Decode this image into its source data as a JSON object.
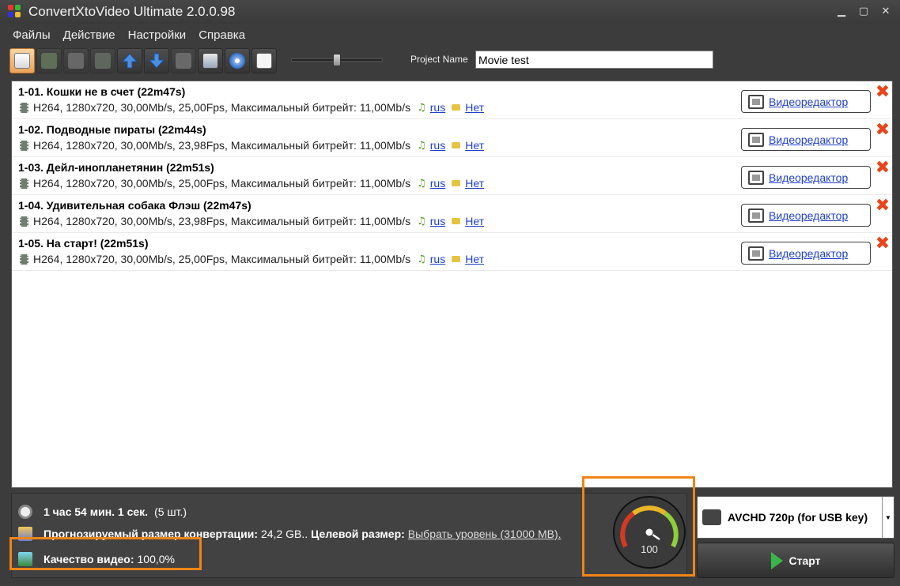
{
  "window": {
    "title": "ConvertXtoVideo Ultimate 2.0.0.98"
  },
  "menu": [
    "Файлы",
    "Действие",
    "Настройки",
    "Справка"
  ],
  "toolbar": {
    "buttons": [
      {
        "icon": "add-file-icon",
        "state": "active"
      },
      {
        "icon": "add-audio-icon",
        "state": "disabled"
      },
      {
        "icon": "add-subtitle-icon",
        "state": "disabled"
      },
      {
        "icon": "add-image-icon",
        "state": "disabled"
      },
      {
        "icon": "move-up-icon",
        "state": "normal"
      },
      {
        "icon": "move-down-icon",
        "state": "normal"
      },
      {
        "icon": "remove-icon",
        "state": "disabled"
      },
      {
        "icon": "screen-settings-icon",
        "state": "normal"
      },
      {
        "icon": "burn-disc-icon",
        "state": "normal"
      },
      {
        "icon": "preview-icon",
        "state": "normal"
      }
    ],
    "slider_level": 0.5
  },
  "project": {
    "label": "Project Name",
    "value": "Movie test"
  },
  "files": [
    {
      "title": "1-01. Кошки не в счет (22m47s)",
      "info": "H264, 1280x720, 30,00Mb/s, 25,00Fps, Максимальный битрейт: 11,00Mb/s",
      "audio": "rus",
      "subtitle": "Нет",
      "editor": "Видеоредактор"
    },
    {
      "title": "1-02. Подводные пираты (22m44s)",
      "info": "H264, 1280x720, 30,00Mb/s, 23,98Fps, Максимальный битрейт: 11,00Mb/s",
      "audio": "rus",
      "subtitle": "Нет",
      "editor": "Видеоредактор"
    },
    {
      "title": "1-03. Дейл-инопланетянин (22m51s)",
      "info": "H264, 1280x720, 30,00Mb/s, 25,00Fps, Максимальный битрейт: 11,00Mb/s",
      "audio": "rus",
      "subtitle": "Нет",
      "editor": "Видеоредактор"
    },
    {
      "title": "1-04. Удивительная собака Флэш (22m47s)",
      "info": "H264, 1280x720, 30,00Mb/s, 23,98Fps, Максимальный битрейт: 11,00Mb/s",
      "audio": "rus",
      "subtitle": "Нет",
      "editor": "Видеоредактор"
    },
    {
      "title": "1-05. На старт! (22m51s)",
      "info": "H264, 1280x720, 30,00Mb/s, 25,00Fps, Максимальный битрейт: 11,00Mb/s",
      "audio": "rus",
      "subtitle": "Нет",
      "editor": "Видеоредактор"
    }
  ],
  "summary": {
    "duration": "1 час 54 мин. 1 сек.",
    "count": "(5 шт.)",
    "size_label": "Прогнозируемый размер конвертации:",
    "size_value": "24,2 GB..",
    "target_label": "Целевой размер:",
    "target_link": "Выбрать уровень (31000 MB).",
    "quality_label": "Качество видео:",
    "quality_value": "100,0%"
  },
  "gauge": {
    "value": "100"
  },
  "profile": {
    "label": "AVCHD 720p (for USB key)"
  },
  "start_button": {
    "label": "Старт"
  }
}
